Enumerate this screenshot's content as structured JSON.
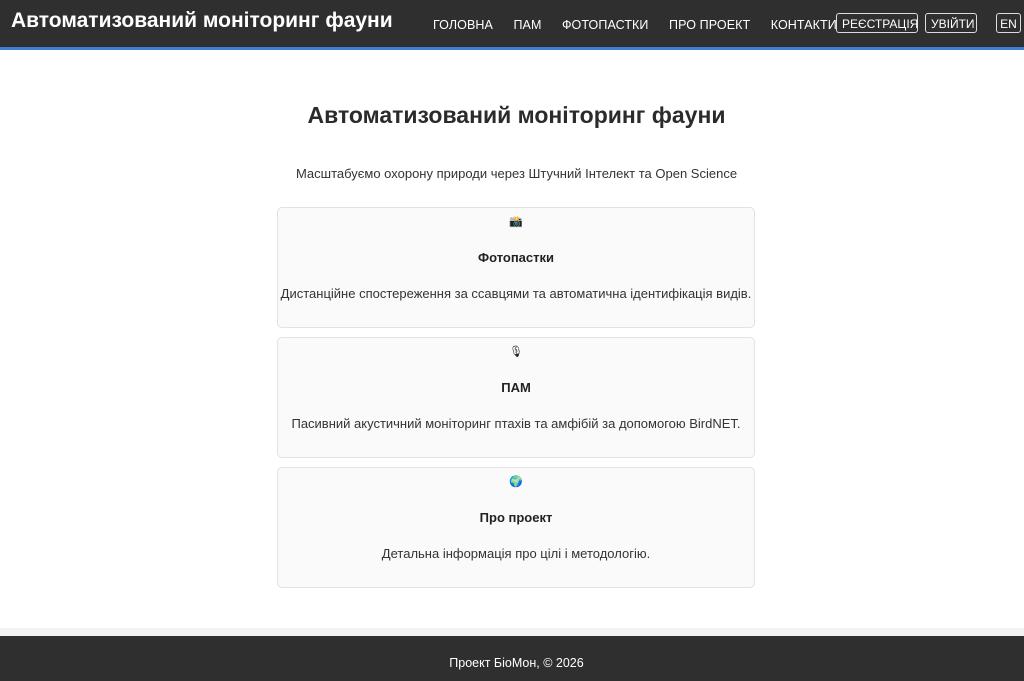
{
  "header": {
    "brand": "Автоматизований моніторинг фауни",
    "nav": [
      "ГОЛОВНА",
      "ПАМ",
      "ФОТОПАСТКИ",
      "ПРО ПРОЕКТ",
      "КОНТАКТИ"
    ],
    "register_label": "РЕЄСТРАЦІЯ",
    "login_label": "УВІЙТИ",
    "lang_label": "EN",
    "accent_color": "#3d7fd6"
  },
  "hero": {
    "title": "Автоматизований моніторинг фауни",
    "subtitle": "Масштабуємо охорону природи через Штучний Інтелект та Open Science"
  },
  "cards": [
    {
      "icon": "camera-icon",
      "glyph": "📸",
      "title": "Фотопастки",
      "description": "Дистанційне спостереження за ссавцями та автоматична ідентифікація видів."
    },
    {
      "icon": "microphone-icon",
      "glyph": "🎙",
      "title": "ПАМ",
      "description": "Пасивний акустичний моніторинг птахів та амфібій за допомогою BirdNET."
    },
    {
      "icon": "globe-icon",
      "glyph": "🌍",
      "title": "Про проект",
      "description": "Детальна інформація про цілі і методологію."
    }
  ],
  "footer": {
    "text": "Проект БіоМон, © 2026"
  }
}
